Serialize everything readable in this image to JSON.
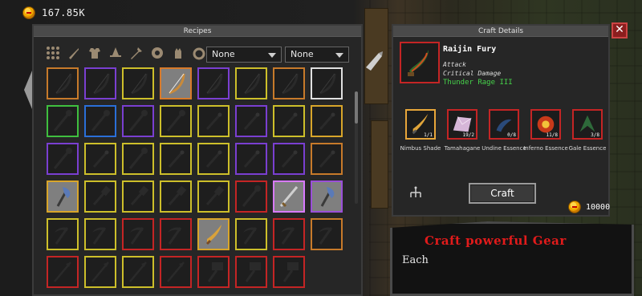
{
  "currency": {
    "amount": "167.85K",
    "icon": "coin-icon"
  },
  "recipes": {
    "title": "Recipes",
    "filters": [
      "all-grid-icon",
      "sword-icon",
      "armor-icon",
      "hat-icon",
      "staff-icon",
      "shield-icon",
      "gloves-icon",
      "ring-icon"
    ],
    "dropdown1": "None",
    "dropdown2": "None",
    "slots": [
      [
        "#c77a2a",
        "bow"
      ],
      [
        "#7a3fd1",
        "bow"
      ],
      [
        "#cdbf2a",
        "bow"
      ],
      [
        "#d87a2a",
        "bow-lit"
      ],
      [
        "#7a3fd1",
        "bow"
      ],
      [
        "#cdbf2a",
        "bow"
      ],
      [
        "#c77a2a",
        "bow"
      ],
      [
        "#e0e0e0",
        "bow"
      ],
      [
        "#3fbf3f",
        "staff"
      ],
      [
        "#2a6fd8",
        "staff"
      ],
      [
        "#7a3fd1",
        "staff"
      ],
      [
        "#cdbf2a",
        "staff"
      ],
      [
        "#cdbf2a",
        "wand"
      ],
      [
        "#7a3fd1",
        "wand"
      ],
      [
        "#cdbf2a",
        "wand"
      ],
      [
        "#d8a52a",
        "wand"
      ],
      [
        "#7a3fd1",
        "staff"
      ],
      [
        "#cdbf2a",
        "wand"
      ],
      [
        "#cdbf2a",
        "staff"
      ],
      [
        "#cdbf2a",
        "wand"
      ],
      [
        "#cdbf2a",
        "wand"
      ],
      [
        "#7a3fd1",
        "wand"
      ],
      [
        "#7a3fd1",
        "wand"
      ],
      [
        "#c77a2a",
        "wand"
      ],
      [
        "#d8a52a",
        "axe-lit"
      ],
      [
        "#cdbf2a",
        "club"
      ],
      [
        "#cdbf2a",
        "club"
      ],
      [
        "#cdbf2a",
        "club"
      ],
      [
        "#cdbf2a",
        "club"
      ],
      [
        "#c42525",
        "staff"
      ],
      [
        "#d87aff",
        "sword-lit"
      ],
      [
        "#9a4fd8",
        "axe-lit"
      ],
      [
        "#cdbf2a",
        "scythe"
      ],
      [
        "#cdbf2a",
        "scythe"
      ],
      [
        "#c42525",
        "scythe"
      ],
      [
        "#c42525",
        "scythe"
      ],
      [
        "#d8a52a",
        "blade-lit"
      ],
      [
        "#cdbf2a",
        "scythe"
      ],
      [
        "#c42525",
        "scythe"
      ],
      [
        "#c77a2a",
        "scythe"
      ],
      [
        "#c42525",
        "spear"
      ],
      [
        "#cdbf2a",
        "spear"
      ],
      [
        "#cdbf2a",
        "spear"
      ],
      [
        "#c42525",
        "spear"
      ],
      [
        "#c42525",
        "hammer"
      ],
      [
        "#c42525",
        "hammer"
      ],
      [
        "#c42525",
        "hammer"
      ]
    ]
  },
  "details": {
    "title": "Craft Details",
    "item_name": "Raijin Fury",
    "stat1": "Attack",
    "stat2": "Critical Damage",
    "bonus": "Thunder Rage III",
    "ingredients": [
      {
        "name": "Nimbus Shade",
        "qty": "1/1",
        "border": "#e8a63a",
        "icon": "blade"
      },
      {
        "name": "Tamahagane",
        "qty": "19/2",
        "border": "#c42525",
        "icon": "crystal"
      },
      {
        "name": "Undine Essence",
        "qty": "0/8",
        "border": "#c42525",
        "icon": "essence-blue"
      },
      {
        "name": "Inferno Essence",
        "qty": "11/8",
        "border": "#c42525",
        "icon": "essence-red"
      },
      {
        "name": "Gale Essence",
        "qty": "3/8",
        "border": "#c42525",
        "icon": "essence-green"
      }
    ],
    "craft_label": "Craft",
    "cost": "10000"
  },
  "banner": {
    "title": "Craft powerful Gear",
    "text": "Each"
  }
}
